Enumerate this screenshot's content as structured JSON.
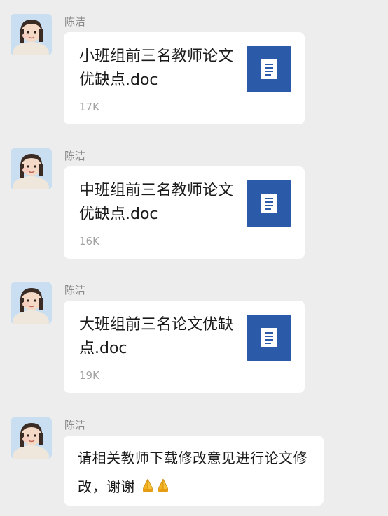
{
  "messages": [
    {
      "sender": "陈洁",
      "type": "file",
      "file_name": "小班组前三名教师论文优缺点.doc",
      "file_size": "17K",
      "file_icon": "word-document-icon",
      "file_icon_color": "#2b5aa8"
    },
    {
      "sender": "陈洁",
      "type": "file",
      "file_name": "中班组前三名教师论文优缺点.doc",
      "file_size": "16K",
      "file_icon": "word-document-icon",
      "file_icon_color": "#2b5aa8"
    },
    {
      "sender": "陈洁",
      "type": "file",
      "file_name": "大班组前三名论文优缺点.doc",
      "file_size": "19K",
      "file_icon": "word-document-icon",
      "file_icon_color": "#2b5aa8"
    },
    {
      "sender": "陈洁",
      "type": "text",
      "text": "请相关教师下载修改意见进行论文修改，谢谢",
      "emoji": [
        "folded-hands-emoji",
        "folded-hands-emoji"
      ]
    }
  ],
  "colors": {
    "background": "#ededed",
    "bubble": "#ffffff",
    "sender_name": "#8a8a8a",
    "file_size": "#a3a3a3",
    "doc_icon": "#2b5aa8"
  }
}
